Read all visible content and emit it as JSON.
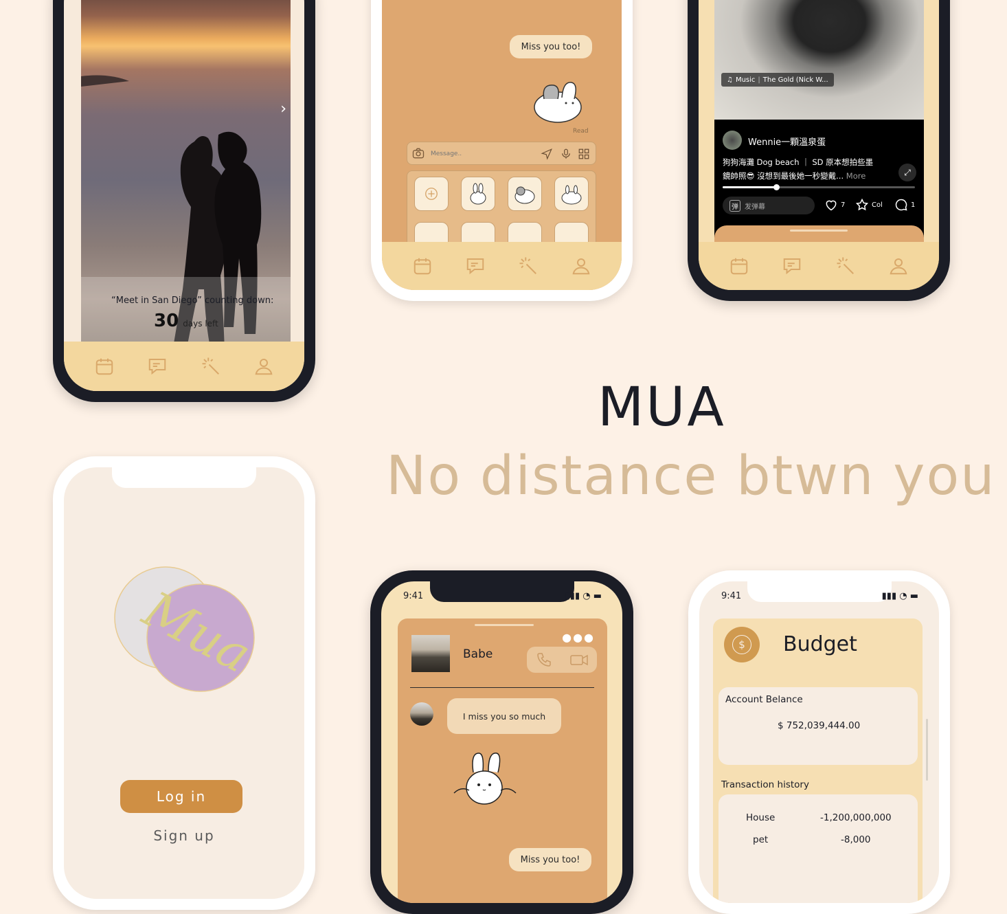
{
  "hero": {
    "title": "MUA",
    "subtitle": "No distance btwn you"
  },
  "tabbar": {
    "icons": [
      "calendar-icon",
      "chat-icon",
      "magic-wand-icon",
      "profile-icon"
    ]
  },
  "countdown": {
    "caption": "“Meet in San Diego” counting down:",
    "number": "30",
    "unit": "days left"
  },
  "chat1": {
    "message": "Miss you too!",
    "read_label": "Read",
    "input_placeholder": "Message.."
  },
  "video": {
    "music_label": "Music",
    "music_track": "The Gold (Nick W...",
    "author": "Wennie一顆溫泉蛋",
    "caption_line1": "狗狗海灘 Dog beach ｜ SD 原本想拍些墨",
    "caption_line2": "鏡帥照😎 沒想到最後她一秒變戴...",
    "more_label": "More",
    "danmu_placeholder": "发弹幕",
    "danmu_icon_text": "弹",
    "likes": "7",
    "collect_label": "Col",
    "comments": "1",
    "progress": 0.28
  },
  "login": {
    "logo_text": "Mua",
    "login_button": "Log in",
    "signup_link": "Sign up"
  },
  "chat2": {
    "time": "9:41",
    "contact": "Babe",
    "message_in": "I miss you so much",
    "message_out": "Miss you too!"
  },
  "budget": {
    "time": "9:41",
    "title": "Budget",
    "balance_label": "Account Belance",
    "balance_value": "$ 752,039,444.00",
    "history_label": "Transaction history",
    "transactions": [
      {
        "name": "House",
        "amount": "-1,200,000,000"
      },
      {
        "name": "pet",
        "amount": "-8,000"
      }
    ]
  },
  "colors": {
    "background": "#fdf1e6",
    "accent": "#d09a50",
    "dark_frame": "#1b1d26",
    "tabbar": "#f3d79e"
  }
}
